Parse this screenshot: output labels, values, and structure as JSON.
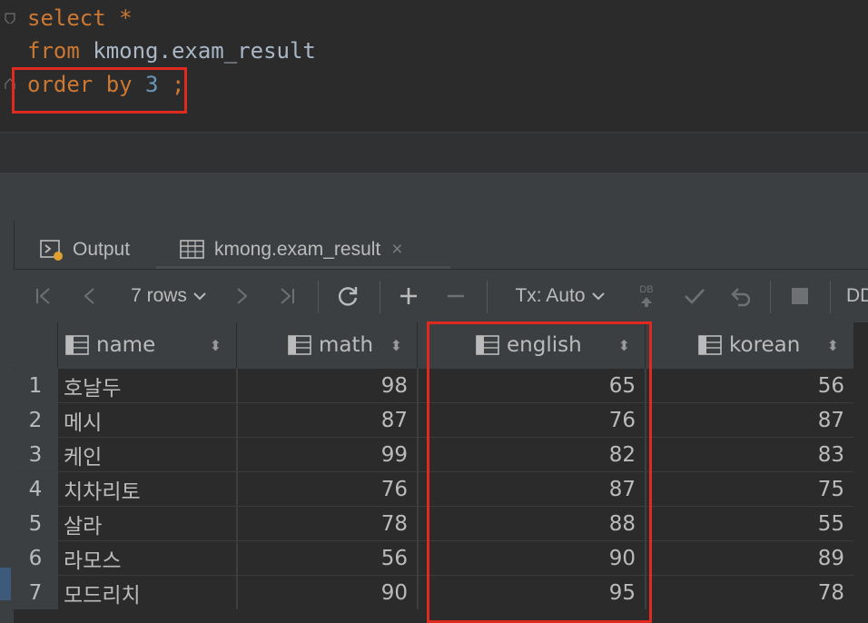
{
  "editor": {
    "line1": {
      "kw": "select",
      "rest": " *"
    },
    "line2": {
      "kw": "from",
      "rest": " kmong.exam_result"
    },
    "line3": {
      "kw1": "order",
      "kw2": " by",
      "num": " 3",
      "end": " ;"
    }
  },
  "tabs": {
    "output": "Output",
    "table": "kmong.exam_result",
    "close": "×"
  },
  "toolbar": {
    "rows": "7 rows",
    "tx": "Tx: Auto",
    "db": "DB",
    "ddl": "DD"
  },
  "columns": [
    "name",
    "math",
    "english",
    "korean"
  ],
  "rows": [
    {
      "n": "1",
      "name": "호날두",
      "math": "98",
      "english": "65",
      "korean": "56"
    },
    {
      "n": "2",
      "name": "메시",
      "math": "87",
      "english": "76",
      "korean": "87"
    },
    {
      "n": "3",
      "name": "케인",
      "math": "99",
      "english": "82",
      "korean": "83"
    },
    {
      "n": "4",
      "name": "치차리토",
      "math": "76",
      "english": "87",
      "korean": "75"
    },
    {
      "n": "5",
      "name": "살라",
      "math": "78",
      "english": "88",
      "korean": "55"
    },
    {
      "n": "6",
      "name": "라모스",
      "math": "56",
      "english": "90",
      "korean": "89"
    },
    {
      "n": "7",
      "name": "모드리치",
      "math": "90",
      "english": "95",
      "korean": "78"
    }
  ],
  "colors": {
    "highlight": "#e02a20",
    "keyword": "#cc7832",
    "number": "#6897bb"
  }
}
